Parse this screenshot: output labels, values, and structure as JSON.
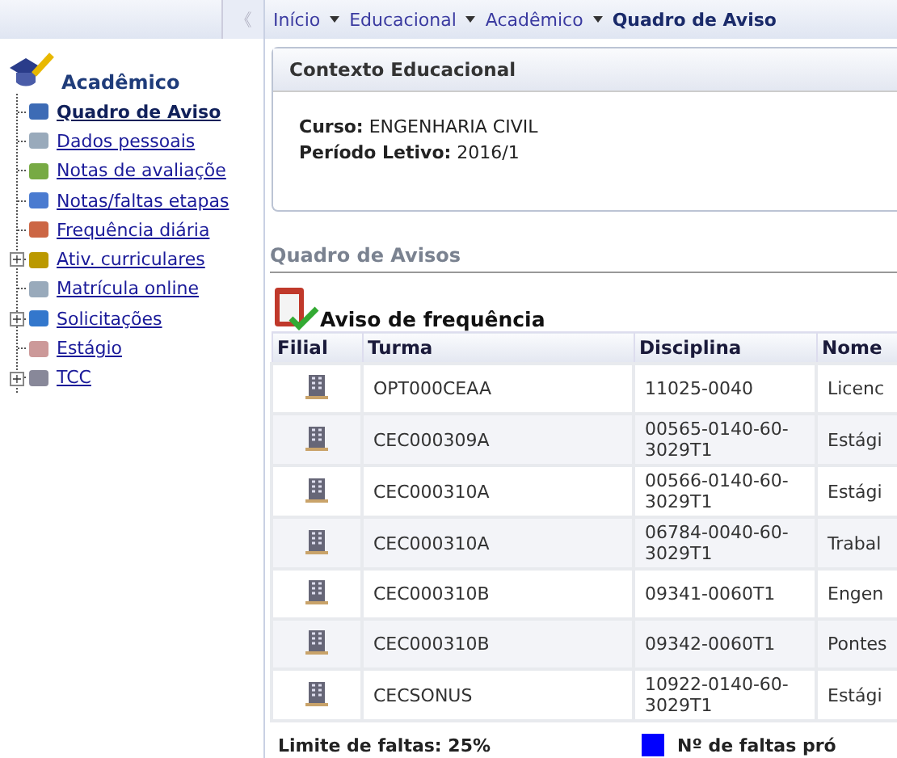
{
  "sidebar": {
    "collapse_label": "《",
    "title": "Acadêmico",
    "items": [
      {
        "label": "Quadro de Aviso",
        "selected": true
      },
      {
        "label": "Dados pessoais",
        "selected": false
      },
      {
        "label": "Notas de avaliaçõe",
        "selected": false
      },
      {
        "label": "Notas/faltas etapas",
        "selected": false
      },
      {
        "label": "Frequência diária",
        "selected": false
      },
      {
        "label": "Ativ. curriculares",
        "selected": false,
        "expander": "+"
      },
      {
        "label": "Matrícula online",
        "selected": false
      },
      {
        "label": "Solicitações",
        "selected": false,
        "expander": "+"
      },
      {
        "label": "Estágio",
        "selected": false
      },
      {
        "label": "TCC",
        "selected": false,
        "expander": "+"
      }
    ]
  },
  "breadcrumb": [
    {
      "label": "Início",
      "current": false
    },
    {
      "label": "Educacional",
      "current": false
    },
    {
      "label": "Acadêmico",
      "current": false
    },
    {
      "label": "Quadro de Aviso",
      "current": true
    }
  ],
  "context_panel": {
    "title": "Contexto Educacional",
    "fields": [
      {
        "label": "Curso:",
        "value": "ENGENHARIA CIVIL"
      },
      {
        "label": "Período Letivo:",
        "value": "2016/1"
      }
    ]
  },
  "section_title": "Quadro de Avisos",
  "notice": {
    "title": "Aviso de frequência",
    "columns": [
      "Filial",
      "Turma",
      "Disciplina",
      "Nome"
    ],
    "rows": [
      {
        "turma": "OPT000CEAA",
        "disciplina": "11025-0040",
        "nome": "Licenc"
      },
      {
        "turma": "CEC000309A",
        "disciplina": "00565-0140-60-3029T1",
        "nome": "Estági"
      },
      {
        "turma": "CEC000310A",
        "disciplina": "00566-0140-60-3029T1",
        "nome": "Estági"
      },
      {
        "turma": "CEC000310A",
        "disciplina": "06784-0040-60-3029T1",
        "nome": "Trabal"
      },
      {
        "turma": "CEC000310B",
        "disciplina": "09341-0060T1",
        "nome": "Engen"
      },
      {
        "turma": "CEC000310B",
        "disciplina": "09342-0060T1",
        "nome": "Pontes"
      },
      {
        "turma": "CECSONUS",
        "disciplina": "10922-0140-60-3029T1",
        "nome": "Estági"
      }
    ],
    "limit": "Limite de faltas: 25%",
    "legend": {
      "label": "Nº de faltas pró",
      "color": "#0000ff"
    }
  }
}
